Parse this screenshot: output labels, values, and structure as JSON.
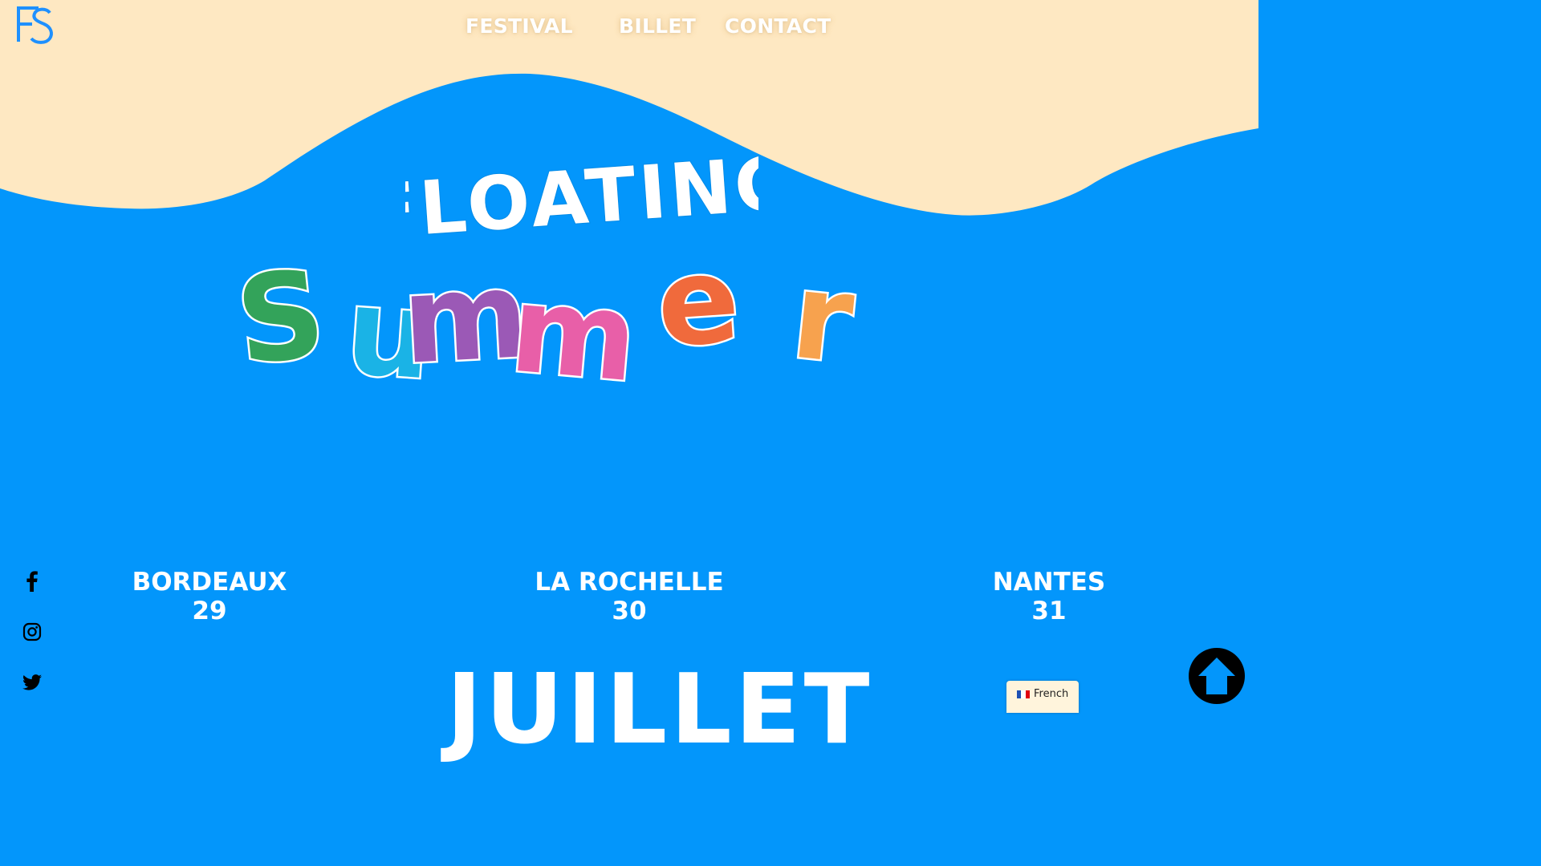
{
  "header": {
    "logo_text": "FS",
    "nav": [
      {
        "label": "FESTIVAL"
      },
      {
        "label": "BILLET"
      },
      {
        "label": "CONTACT"
      }
    ]
  },
  "hero": {
    "title_top": "FLOATING",
    "title_bottom": "Summer",
    "letter_colors": [
      "#33a35a",
      "#1ab3e6",
      "#9b59b6",
      "#e85fa8",
      "#f06a3c",
      "#f7a24e"
    ]
  },
  "social": [
    {
      "name": "facebook-icon"
    },
    {
      "name": "instagram-icon"
    },
    {
      "name": "twitter-icon"
    }
  ],
  "dates": [
    {
      "city": "BORDEAUX",
      "day": "29"
    },
    {
      "city": "LA ROCHELLE",
      "day": "30"
    },
    {
      "city": "NANTES",
      "day": "31"
    }
  ],
  "month": "JUILLET",
  "language": {
    "label": "French",
    "flag_colors": [
      "#1e50b4",
      "#ffffff",
      "#e1000f"
    ]
  },
  "colors": {
    "background": "#0396fb",
    "sand": "#fee8c2",
    "logo": "#1e90ff"
  }
}
